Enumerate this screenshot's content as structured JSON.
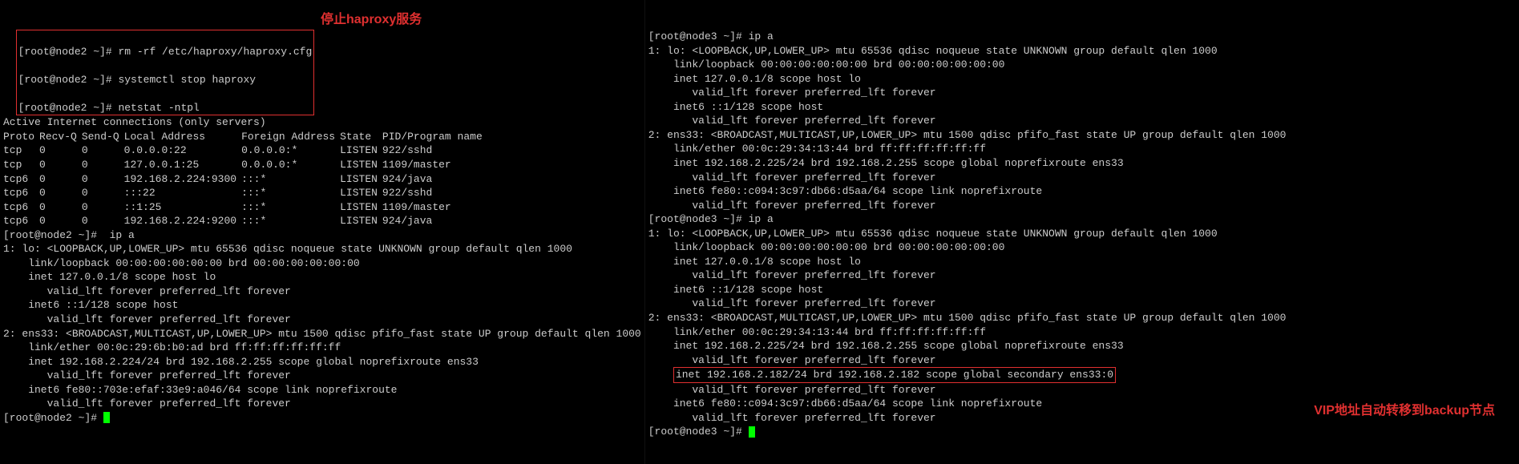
{
  "left": {
    "box": {
      "l1_prompt": "[root@node2 ~]# ",
      "l1_cmd": "rm -rf /etc/haproxy/haproxy.cfg",
      "l2_prompt": "[root@node2 ~]# ",
      "l2_cmd": "systemctl stop haproxy",
      "l3_prompt": "[root@node2 ~]# ",
      "l3_cmd": "netstat -ntpl"
    },
    "annot": "停止haproxy服务",
    "netstat_title": "Active Internet connections (only servers)",
    "netstat_header": [
      "Proto",
      "Recv-Q",
      "Send-Q",
      "Local Address",
      "Foreign Address",
      "State",
      "PID/Program name"
    ],
    "netstat_rows": [
      [
        "tcp",
        "0",
        "0",
        "0.0.0.0:22",
        "0.0.0.0:*",
        "LISTEN",
        "922/sshd"
      ],
      [
        "tcp",
        "0",
        "0",
        "127.0.0.1:25",
        "0.0.0.0:*",
        "LISTEN",
        "1109/master"
      ],
      [
        "tcp6",
        "0",
        "0",
        "192.168.2.224:9300",
        ":::*",
        "LISTEN",
        "924/java"
      ],
      [
        "tcp6",
        "0",
        "0",
        ":::22",
        ":::*",
        "LISTEN",
        "922/sshd"
      ],
      [
        "tcp6",
        "0",
        "0",
        "::1:25",
        ":::*",
        "LISTEN",
        "1109/master"
      ],
      [
        "tcp6",
        "0",
        "0",
        "192.168.2.224:9200",
        ":::*",
        "LISTEN",
        "924/java"
      ]
    ],
    "ipa_prompt": "[root@node2 ~]#  ",
    "ipa_cmd": "ip a",
    "ipa_lines": [
      "1: lo: <LOOPBACK,UP,LOWER_UP> mtu 65536 qdisc noqueue state UNKNOWN group default qlen 1000",
      "    link/loopback 00:00:00:00:00:00 brd 00:00:00:00:00:00",
      "    inet 127.0.0.1/8 scope host lo",
      "       valid_lft forever preferred_lft forever",
      "    inet6 ::1/128 scope host",
      "       valid_lft forever preferred_lft forever",
      "2: ens33: <BROADCAST,MULTICAST,UP,LOWER_UP> mtu 1500 qdisc pfifo_fast state UP group default qlen 1000",
      "    link/ether 00:0c:29:6b:b0:ad brd ff:ff:ff:ff:ff:ff",
      "    inet 192.168.2.224/24 brd 192.168.2.255 scope global noprefixroute ens33",
      "       valid_lft forever preferred_lft forever",
      "    inet6 fe80::703e:efaf:33e9:a046/64 scope link noprefixroute",
      "       valid_lft forever preferred_lft forever"
    ],
    "final_prompt": "[root@node2 ~]# "
  },
  "right": {
    "ipa1_prompt": "[root@node3 ~]# ",
    "ipa1_cmd": "ip a",
    "ipa1_lines": [
      "1: lo: <LOOPBACK,UP,LOWER_UP> mtu 65536 qdisc noqueue state UNKNOWN group default qlen 1000",
      "    link/loopback 00:00:00:00:00:00 brd 00:00:00:00:00:00",
      "    inet 127.0.0.1/8 scope host lo",
      "       valid_lft forever preferred_lft forever",
      "    inet6 ::1/128 scope host",
      "       valid_lft forever preferred_lft forever",
      "2: ens33: <BROADCAST,MULTICAST,UP,LOWER_UP> mtu 1500 qdisc pfifo_fast state UP group default qlen 1000",
      "    link/ether 00:0c:29:34:13:44 brd ff:ff:ff:ff:ff:ff",
      "    inet 192.168.2.225/24 brd 192.168.2.255 scope global noprefixroute ens33",
      "       valid_lft forever preferred_lft forever",
      "    inet6 fe80::c094:3c97:db66:d5aa/64 scope link noprefixroute",
      "       valid_lft forever preferred_lft forever"
    ],
    "ipa2_prompt": "[root@node3 ~]# ",
    "ipa2_cmd": "ip a",
    "ipa2_lines_before_vip": [
      "1: lo: <LOOPBACK,UP,LOWER_UP> mtu 65536 qdisc noqueue state UNKNOWN group default qlen 1000",
      "    link/loopback 00:00:00:00:00:00 brd 00:00:00:00:00:00",
      "    inet 127.0.0.1/8 scope host lo",
      "       valid_lft forever preferred_lft forever",
      "    inet6 ::1/128 scope host",
      "       valid_lft forever preferred_lft forever",
      "2: ens33: <BROADCAST,MULTICAST,UP,LOWER_UP> mtu 1500 qdisc pfifo_fast state UP group default qlen 1000",
      "    link/ether 00:0c:29:34:13:44 brd ff:ff:ff:ff:ff:ff",
      "    inet 192.168.2.225/24 brd 192.168.2.255 scope global noprefixroute ens33",
      "       valid_lft forever preferred_lft forever"
    ],
    "vip_line": "inet 192.168.2.182/24 brd 192.168.2.182 scope global secondary ens33:0",
    "ipa2_lines_after_vip": [
      "       valid_lft forever preferred_lft forever",
      "    inet6 fe80::c094:3c97:db66:d5aa/64 scope link noprefixroute",
      "       valid_lft forever preferred_lft forever"
    ],
    "final_prompt": "[root@node3 ~]# ",
    "annot": "VIP地址自动转移到backup节点"
  }
}
